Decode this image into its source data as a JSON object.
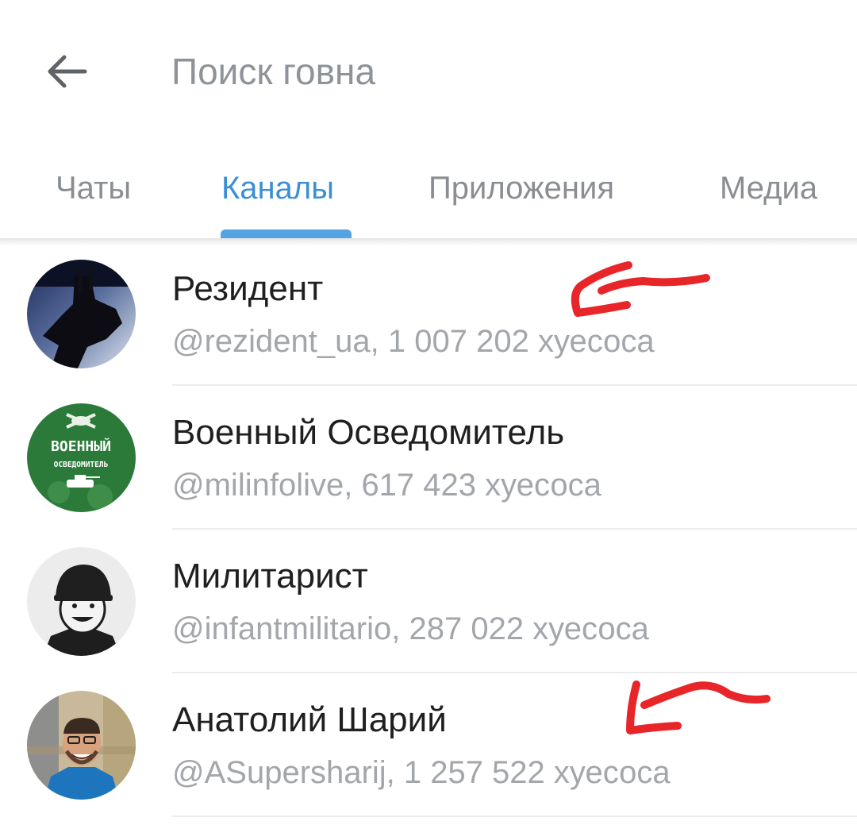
{
  "header": {
    "back_icon": "arrow-left-icon",
    "search_value": "",
    "search_placeholder": "Поиск говна"
  },
  "tabs": [
    {
      "label": "Чаты",
      "active": false
    },
    {
      "label": "Каналы",
      "active": true
    },
    {
      "label": "Приложения",
      "active": false
    },
    {
      "label": "Медиа",
      "active": false
    }
  ],
  "colors": {
    "accent": "#3c8fd6",
    "indicator": "#56a3e1",
    "secondary_text": "#a3a6aa",
    "annotation": "#e8262a"
  },
  "channels": [
    {
      "name": "Резидент",
      "subtitle": "@rezident_ua, 1 007 202 хуесоса",
      "avatar": "dark-silhouette-avatar"
    },
    {
      "name": "Военный Осведомитель",
      "subtitle": "@milinfolive, 617 423 хуесоса",
      "avatar": "green-badge-avatar",
      "avatar_text_1": "ВОЕННЫЙ",
      "avatar_text_2": "ОСВЕДОМИТЕЛЬ"
    },
    {
      "name": "Милитарист",
      "subtitle": "@infantmilitario, 287 022 хуесоса",
      "avatar": "helmet-cartoon-avatar"
    },
    {
      "name": "Анатолий Шарий",
      "subtitle": "@ASupersharij, 1 257 522 хуесоса",
      "avatar": "photo-person-avatar"
    }
  ],
  "annotations": [
    "red-arrow-scribble",
    "red-arrow-scribble"
  ]
}
